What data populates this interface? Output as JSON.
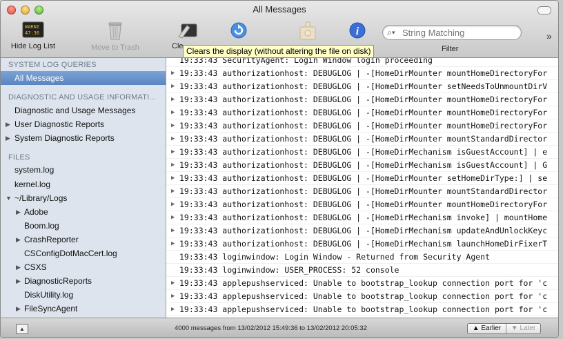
{
  "window": {
    "title": "All Messages"
  },
  "toolbar": {
    "hide_log_list": "Hide Log List",
    "move_to_trash": "Move to Trash",
    "clear_partial": "Cle",
    "search_placeholder": "String Matching",
    "filter_label": "Filter",
    "overflow_glyph": "»",
    "tooltip": "Clears the display (without altering the file on disk)"
  },
  "sidebar": {
    "system_log_queries": "SYSTEM LOG QUERIES",
    "all_messages": "All Messages",
    "diagnostic_header": "DIAGNOSTIC AND USAGE INFORMATI...",
    "diag_usage": "Diagnostic and Usage Messages",
    "user_diag": "User Diagnostic Reports",
    "system_diag": "System Diagnostic Reports",
    "files_header": "FILES",
    "system_log": "system.log",
    "kernel_log": "kernel.log",
    "library_logs": "~/Library/Logs",
    "adobe": "Adobe",
    "boom": "Boom.log",
    "crashreporter": "CrashReporter",
    "csconfig": "CSConfigDotMacCert.log",
    "csxs": "CSXS",
    "diagnosticreports": "DiagnosticReports",
    "diskutility": "DiskUtility.log",
    "filesyncagent": "FileSyncAgent"
  },
  "log": [
    {
      "text": "19:33:43 SecurityAgent: Login Window login proceeding",
      "arrow": false
    },
    {
      "text": "19:33:43 authorizationhost: DEBUGLOG | -[HomeDirMounter mountHomeDirectoryFor",
      "arrow": true
    },
    {
      "text": "19:33:43 authorizationhost: DEBUGLOG | -[HomeDirMounter setNeedsToUnmountDirV",
      "arrow": true
    },
    {
      "text": "19:33:43 authorizationhost: DEBUGLOG | -[HomeDirMounter mountHomeDirectoryFor",
      "arrow": true
    },
    {
      "text": "19:33:43 authorizationhost: DEBUGLOG | -[HomeDirMounter mountHomeDirectoryFor",
      "arrow": true
    },
    {
      "text": "19:33:43 authorizationhost: DEBUGLOG | -[HomeDirMounter mountHomeDirectoryFor",
      "arrow": true
    },
    {
      "text": "19:33:43 authorizationhost: DEBUGLOG | -[HomeDirMounter mountStandardDirector",
      "arrow": true
    },
    {
      "text": "19:33:43 authorizationhost: DEBUGLOG | -[HomeDirMechanism isGuestAccount] | e",
      "arrow": true
    },
    {
      "text": "19:33:43 authorizationhost: DEBUGLOG | -[HomeDirMechanism isGuestAccount] | G",
      "arrow": true
    },
    {
      "text": "19:33:43 authorizationhost: DEBUGLOG | -[HomeDirMounter setHomeDirType:] | se",
      "arrow": true
    },
    {
      "text": "19:33:43 authorizationhost: DEBUGLOG | -[HomeDirMounter mountStandardDirector",
      "arrow": true
    },
    {
      "text": "19:33:43 authorizationhost: DEBUGLOG | -[HomeDirMounter mountHomeDirectoryFor",
      "arrow": true
    },
    {
      "text": "19:33:43 authorizationhost: DEBUGLOG | -[HomeDirMechanism invoke] | mountHome",
      "arrow": true
    },
    {
      "text": "19:33:43 authorizationhost: DEBUGLOG | -[HomeDirMechanism updateAndUnlockKeyc",
      "arrow": true
    },
    {
      "text": "19:33:43 authorizationhost: DEBUGLOG | -[HomeDirMechanism launchHomeDirFixerT",
      "arrow": true
    },
    {
      "text": "19:33:43 loginwindow: Login Window - Returned from Security Agent",
      "arrow": false
    },
    {
      "text": "19:33:43 loginwindow: USER_PROCESS: 52 console",
      "arrow": false
    },
    {
      "text": "19:33:43 applepushserviced: Unable to bootstrap_lookup connection port for 'c",
      "arrow": true
    },
    {
      "text": "19:33:43 applepushserviced: Unable to bootstrap_lookup connection port for 'c",
      "arrow": true
    },
    {
      "text": "19:33:43 applepushserviced: Unable to bootstrap_lookup connection port for 'c",
      "arrow": true
    }
  ],
  "status": {
    "summary": "4000 messages from 13/02/2012 15:49:36 to 13/02/2012 20:05:32",
    "earlier": "Earlier",
    "later": "Later"
  },
  "colors": {
    "selection": "#5a85c2",
    "sidebar_bg": "#dde4ed",
    "tooltip_bg": "#ffffc6"
  },
  "icons": [
    "console-icon",
    "trash-icon",
    "clear-icon",
    "reload-icon",
    "insert-marker-icon",
    "info-icon",
    "search-icon"
  ]
}
